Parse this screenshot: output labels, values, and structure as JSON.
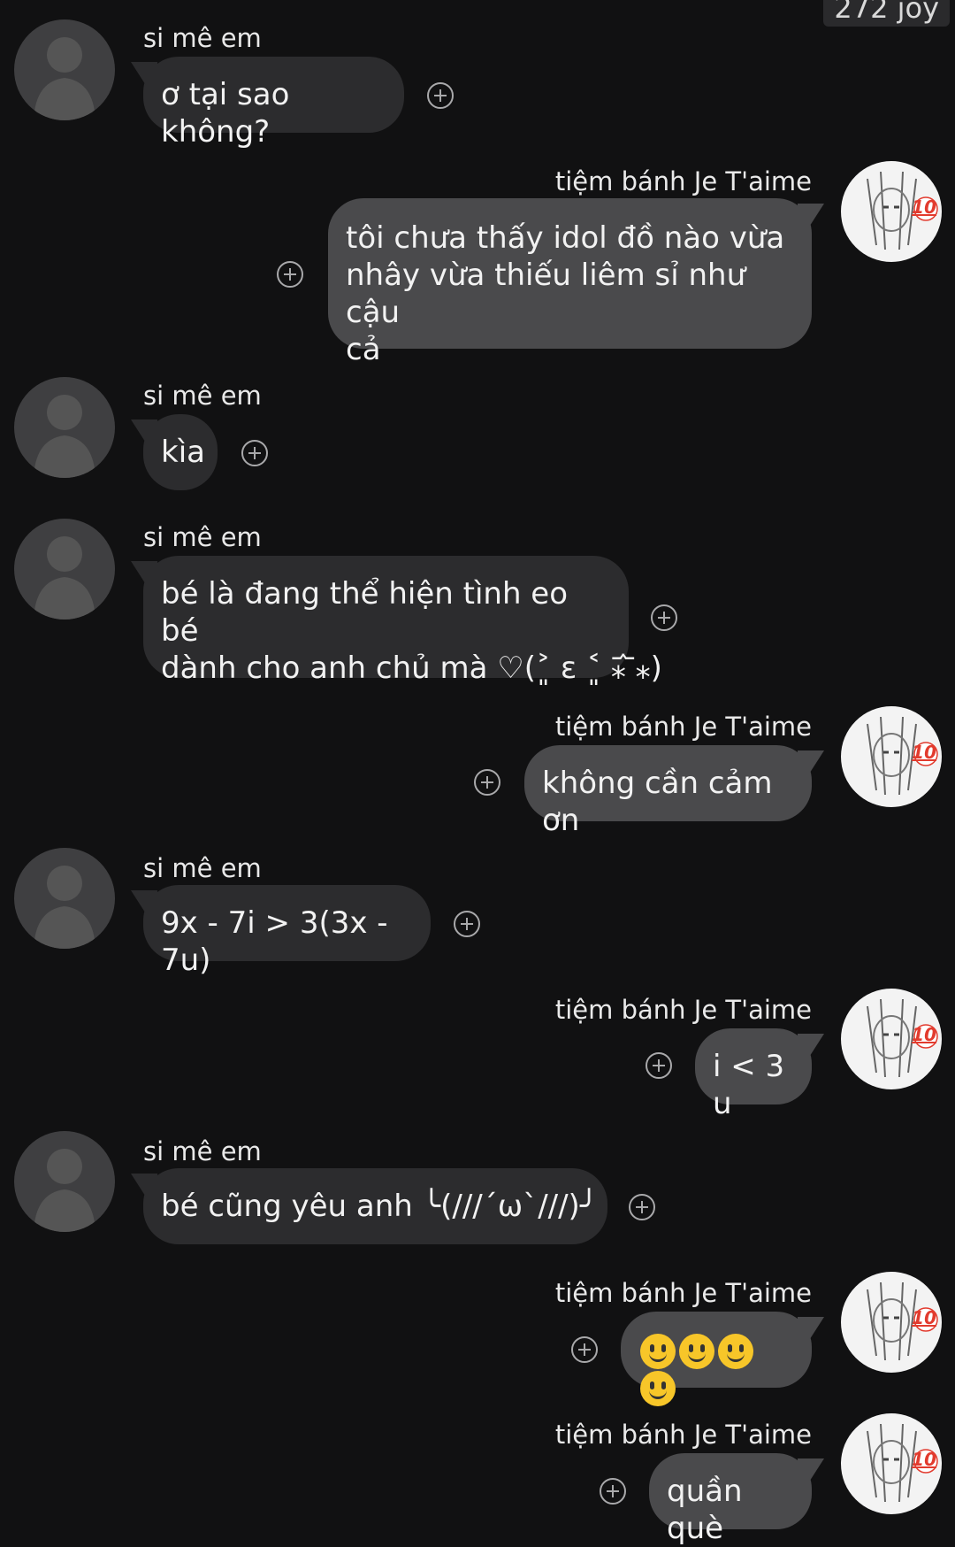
{
  "corner_label": "272 joy",
  "people": {
    "other": "si mê em",
    "me": "tiệm bánh Je T'aime"
  },
  "avatar_badge": "10",
  "messages": [
    {
      "from": "other",
      "text": "ơ tại sao không?"
    },
    {
      "from": "me",
      "lines": [
        "tôi chưa thấy idol đồ nào vừa",
        "nhây vừa thiếu liêm sỉ như cậu",
        "cả"
      ]
    },
    {
      "from": "other",
      "text": "kìa"
    },
    {
      "from": "other",
      "lines": [
        "bé là đang thể hiện tình eo bé",
        "dành cho anh chủ mà ♡(˃͈ ε ˂͈ ⁎᷄ ᷅⁎)"
      ]
    },
    {
      "from": "me",
      "text": "không cần cảm ơn"
    },
    {
      "from": "other",
      "text": "9x - 7i > 3(3x - 7u)"
    },
    {
      "from": "me",
      "text": "i < 3 u"
    },
    {
      "from": "other",
      "text": "bé cũng yêu anh ╰(///´ω`///)╯"
    },
    {
      "from": "me",
      "emoji": [
        "slightly-smiling-face",
        "slightly-smiling-face",
        "slightly-smiling-face",
        "slightly-smiling-face"
      ]
    },
    {
      "from": "me",
      "text": "quần què"
    }
  ]
}
